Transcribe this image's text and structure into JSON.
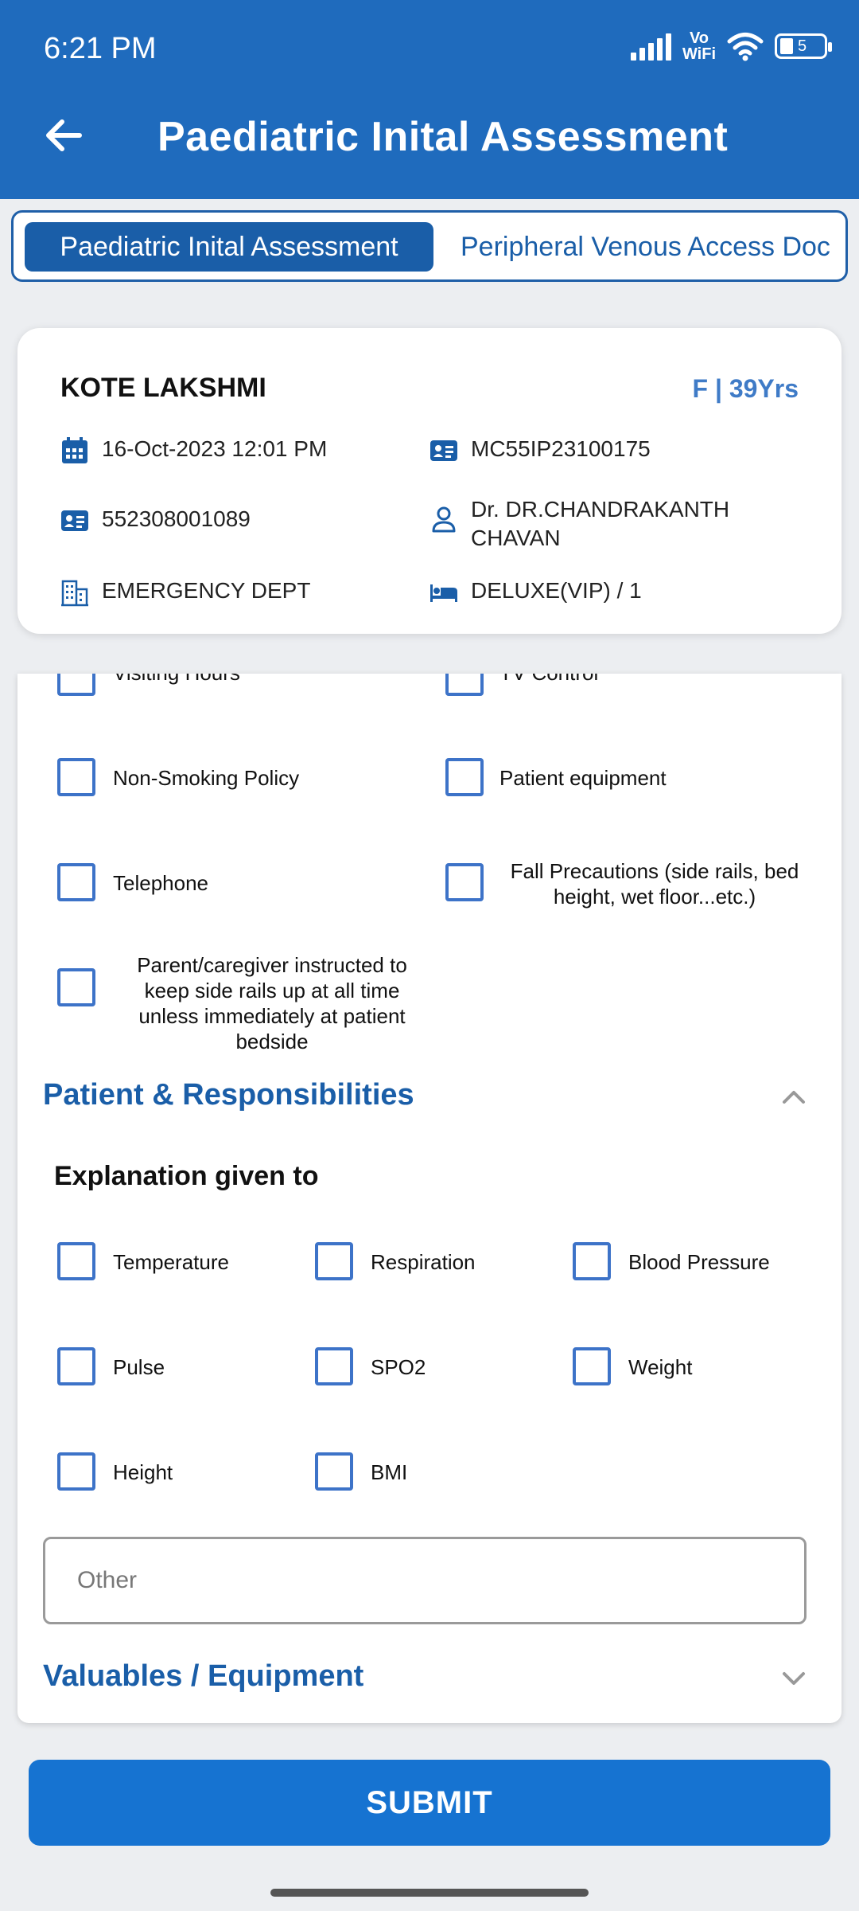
{
  "status_bar": {
    "time": "6:21 PM",
    "vowifi_top": "Vo",
    "vowifi_bottom": "WiFi",
    "battery": "5"
  },
  "header": {
    "title": "Paediatric Inital Assessment"
  },
  "tabs": [
    {
      "label": "Paediatric Inital Assessment",
      "active": true
    },
    {
      "label": "Peripheral Venous Access Doc",
      "active": false
    }
  ],
  "patient": {
    "name": "KOTE LAKSHMI",
    "gender_age": "F | 39Yrs",
    "admit_datetime": "16-Oct-2023 12:01 PM",
    "ip_number": "MC55IP23100175",
    "uhid": "552308001089",
    "doctor": "Dr. DR.CHANDRAKANTH CHAVAN",
    "department": "EMERGENCY DEPT",
    "bed": "DELUXE(VIP) / 1"
  },
  "orientation_items": [
    "Visiting Hours",
    "TV Control",
    "Non-Smoking Policy",
    "Patient equipment",
    "Telephone",
    "Fall Precautions (side rails, bed height, wet floor...etc.)",
    "Parent/caregiver instructed to keep side rails up at all time unless immediately at patient bedside"
  ],
  "responsibilities": {
    "title": "Patient & Responsibilities",
    "subtitle": "Explanation given to",
    "items": [
      "Temperature",
      "Respiration",
      "Blood Pressure",
      "Pulse",
      "SPO2",
      "Weight",
      "Height",
      "BMI"
    ],
    "other_placeholder": "Other"
  },
  "valuables": {
    "title": "Valuables / Equipment"
  },
  "submit_label": "SUBMIT",
  "colors": {
    "primary": "#1f6bbd",
    "accent": "#1a5ea8",
    "checkbox": "#3d73c8",
    "submit": "#1673d1"
  }
}
